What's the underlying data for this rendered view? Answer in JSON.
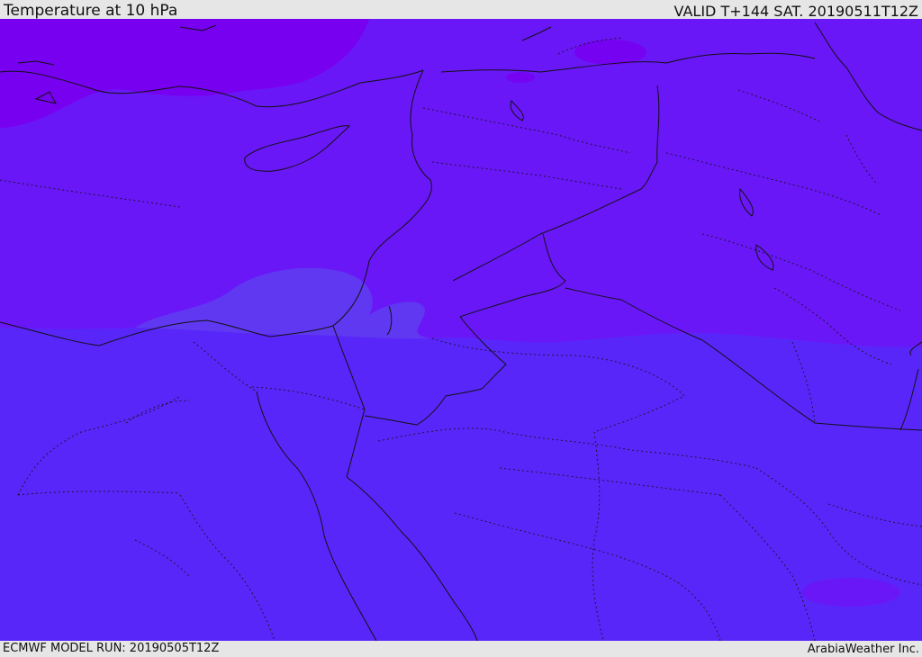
{
  "header": {
    "title": "Temperature at 10 hPa",
    "valid_time": "VALID T+144 SAT. 20190511T12Z"
  },
  "footer": {
    "model_run": "ECMWF MODEL RUN: 20190505T12Z",
    "credit": "ArabiaWeather Inc."
  },
  "map": {
    "colors": {
      "warmest_band": "#7700f0",
      "middle_band": "#6a17f7",
      "cool_band": "#5926fa",
      "coolest_patch": "#5f3cf0",
      "outline": "#111111"
    },
    "icons": [
      "coastline-icon",
      "border-icon"
    ]
  }
}
